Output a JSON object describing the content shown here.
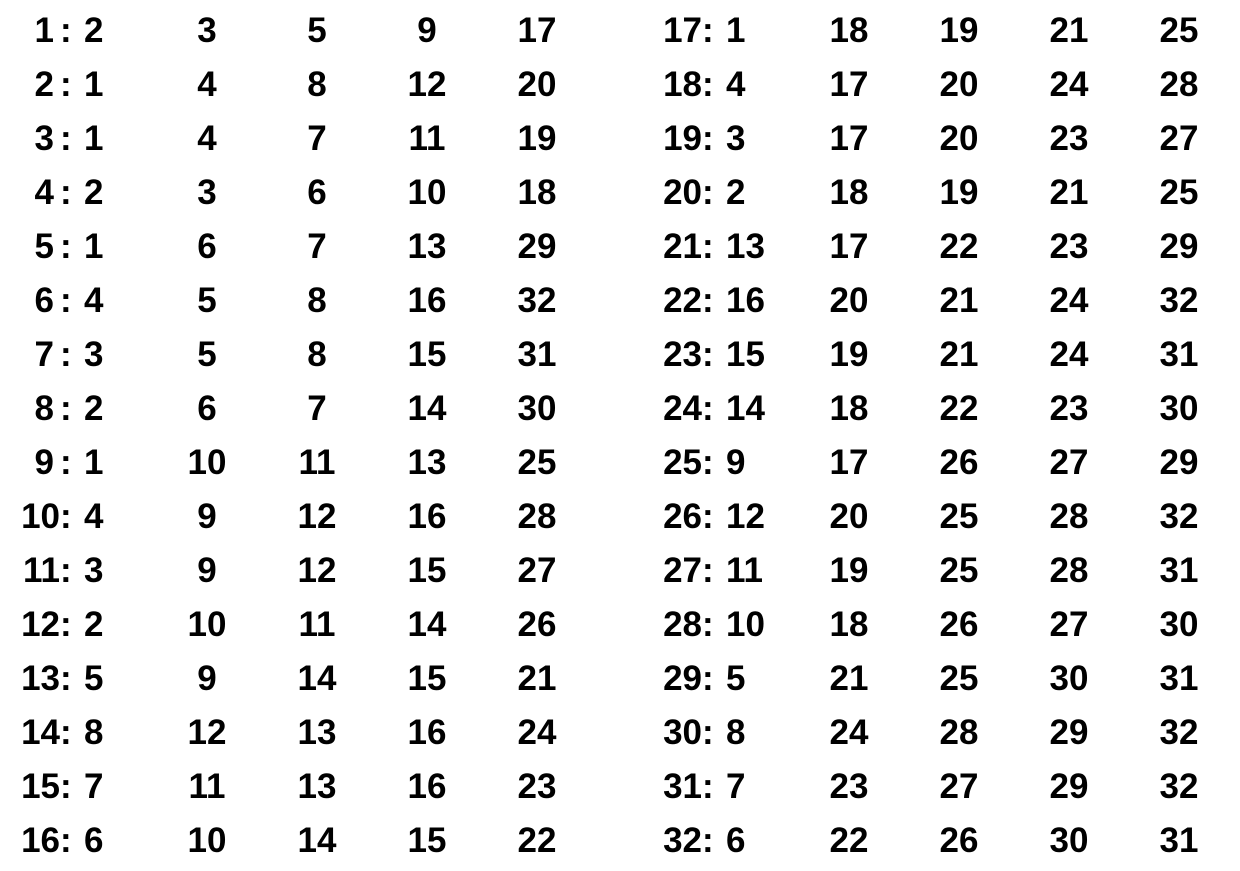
{
  "left": [
    {
      "i": "1",
      "v": [
        "2",
        "3",
        "5",
        "9",
        "17"
      ]
    },
    {
      "i": "2",
      "v": [
        "1",
        "4",
        "8",
        "12",
        "20"
      ]
    },
    {
      "i": "3",
      "v": [
        "1",
        "4",
        "7",
        "11",
        "19"
      ]
    },
    {
      "i": "4",
      "v": [
        "2",
        "3",
        "6",
        "10",
        "18"
      ]
    },
    {
      "i": "5",
      "v": [
        "1",
        "6",
        "7",
        "13",
        "29"
      ]
    },
    {
      "i": "6",
      "v": [
        "4",
        "5",
        "8",
        "16",
        "32"
      ]
    },
    {
      "i": "7",
      "v": [
        "3",
        "5",
        "8",
        "15",
        "31"
      ]
    },
    {
      "i": "8",
      "v": [
        "2",
        "6",
        "7",
        "14",
        "30"
      ]
    },
    {
      "i": "9",
      "v": [
        "1",
        "10",
        "11",
        "13",
        "25"
      ]
    },
    {
      "i": "10",
      "v": [
        "4",
        "9",
        "12",
        "16",
        "28"
      ]
    },
    {
      "i": "11",
      "v": [
        "3",
        "9",
        "12",
        "15",
        "27"
      ]
    },
    {
      "i": "12",
      "v": [
        "2",
        "10",
        "11",
        "14",
        "26"
      ]
    },
    {
      "i": "13",
      "v": [
        "5",
        "9",
        "14",
        "15",
        "21"
      ]
    },
    {
      "i": "14",
      "v": [
        "8",
        "12",
        "13",
        "16",
        "24"
      ]
    },
    {
      "i": "15",
      "v": [
        "7",
        "11",
        "13",
        "16",
        "23"
      ]
    },
    {
      "i": "16",
      "v": [
        "6",
        "10",
        "14",
        "15",
        "22"
      ]
    }
  ],
  "right": [
    {
      "i": "17",
      "v": [
        "1",
        "18",
        "19",
        "21",
        "25"
      ]
    },
    {
      "i": "18",
      "v": [
        "4",
        "17",
        "20",
        "24",
        "28"
      ]
    },
    {
      "i": "19",
      "v": [
        "3",
        "17",
        "20",
        "23",
        "27"
      ]
    },
    {
      "i": "20",
      "v": [
        "2",
        "18",
        "19",
        "21",
        "25"
      ]
    },
    {
      "i": "21",
      "v": [
        "13",
        "17",
        "22",
        "23",
        "29"
      ]
    },
    {
      "i": "22",
      "v": [
        "16",
        "20",
        "21",
        "24",
        "32"
      ]
    },
    {
      "i": "23",
      "v": [
        "15",
        "19",
        "21",
        "24",
        "31"
      ]
    },
    {
      "i": "24",
      "v": [
        "14",
        "18",
        "22",
        "23",
        "30"
      ]
    },
    {
      "i": "25",
      "v": [
        "9",
        "17",
        "26",
        "27",
        "29"
      ]
    },
    {
      "i": "26",
      "v": [
        "12",
        "20",
        "25",
        "28",
        "32"
      ]
    },
    {
      "i": "27",
      "v": [
        "11",
        "19",
        "25",
        "28",
        "31"
      ]
    },
    {
      "i": "28",
      "v": [
        "10",
        "18",
        "26",
        "27",
        "30"
      ]
    },
    {
      "i": "29",
      "v": [
        "5",
        "21",
        "25",
        "30",
        "31"
      ]
    },
    {
      "i": "30",
      "v": [
        "8",
        "24",
        "28",
        "29",
        "32"
      ]
    },
    {
      "i": "31",
      "v": [
        "7",
        "23",
        "27",
        "29",
        "32"
      ]
    },
    {
      "i": "32",
      "v": [
        "6",
        "22",
        "26",
        "30",
        "31"
      ]
    }
  ]
}
